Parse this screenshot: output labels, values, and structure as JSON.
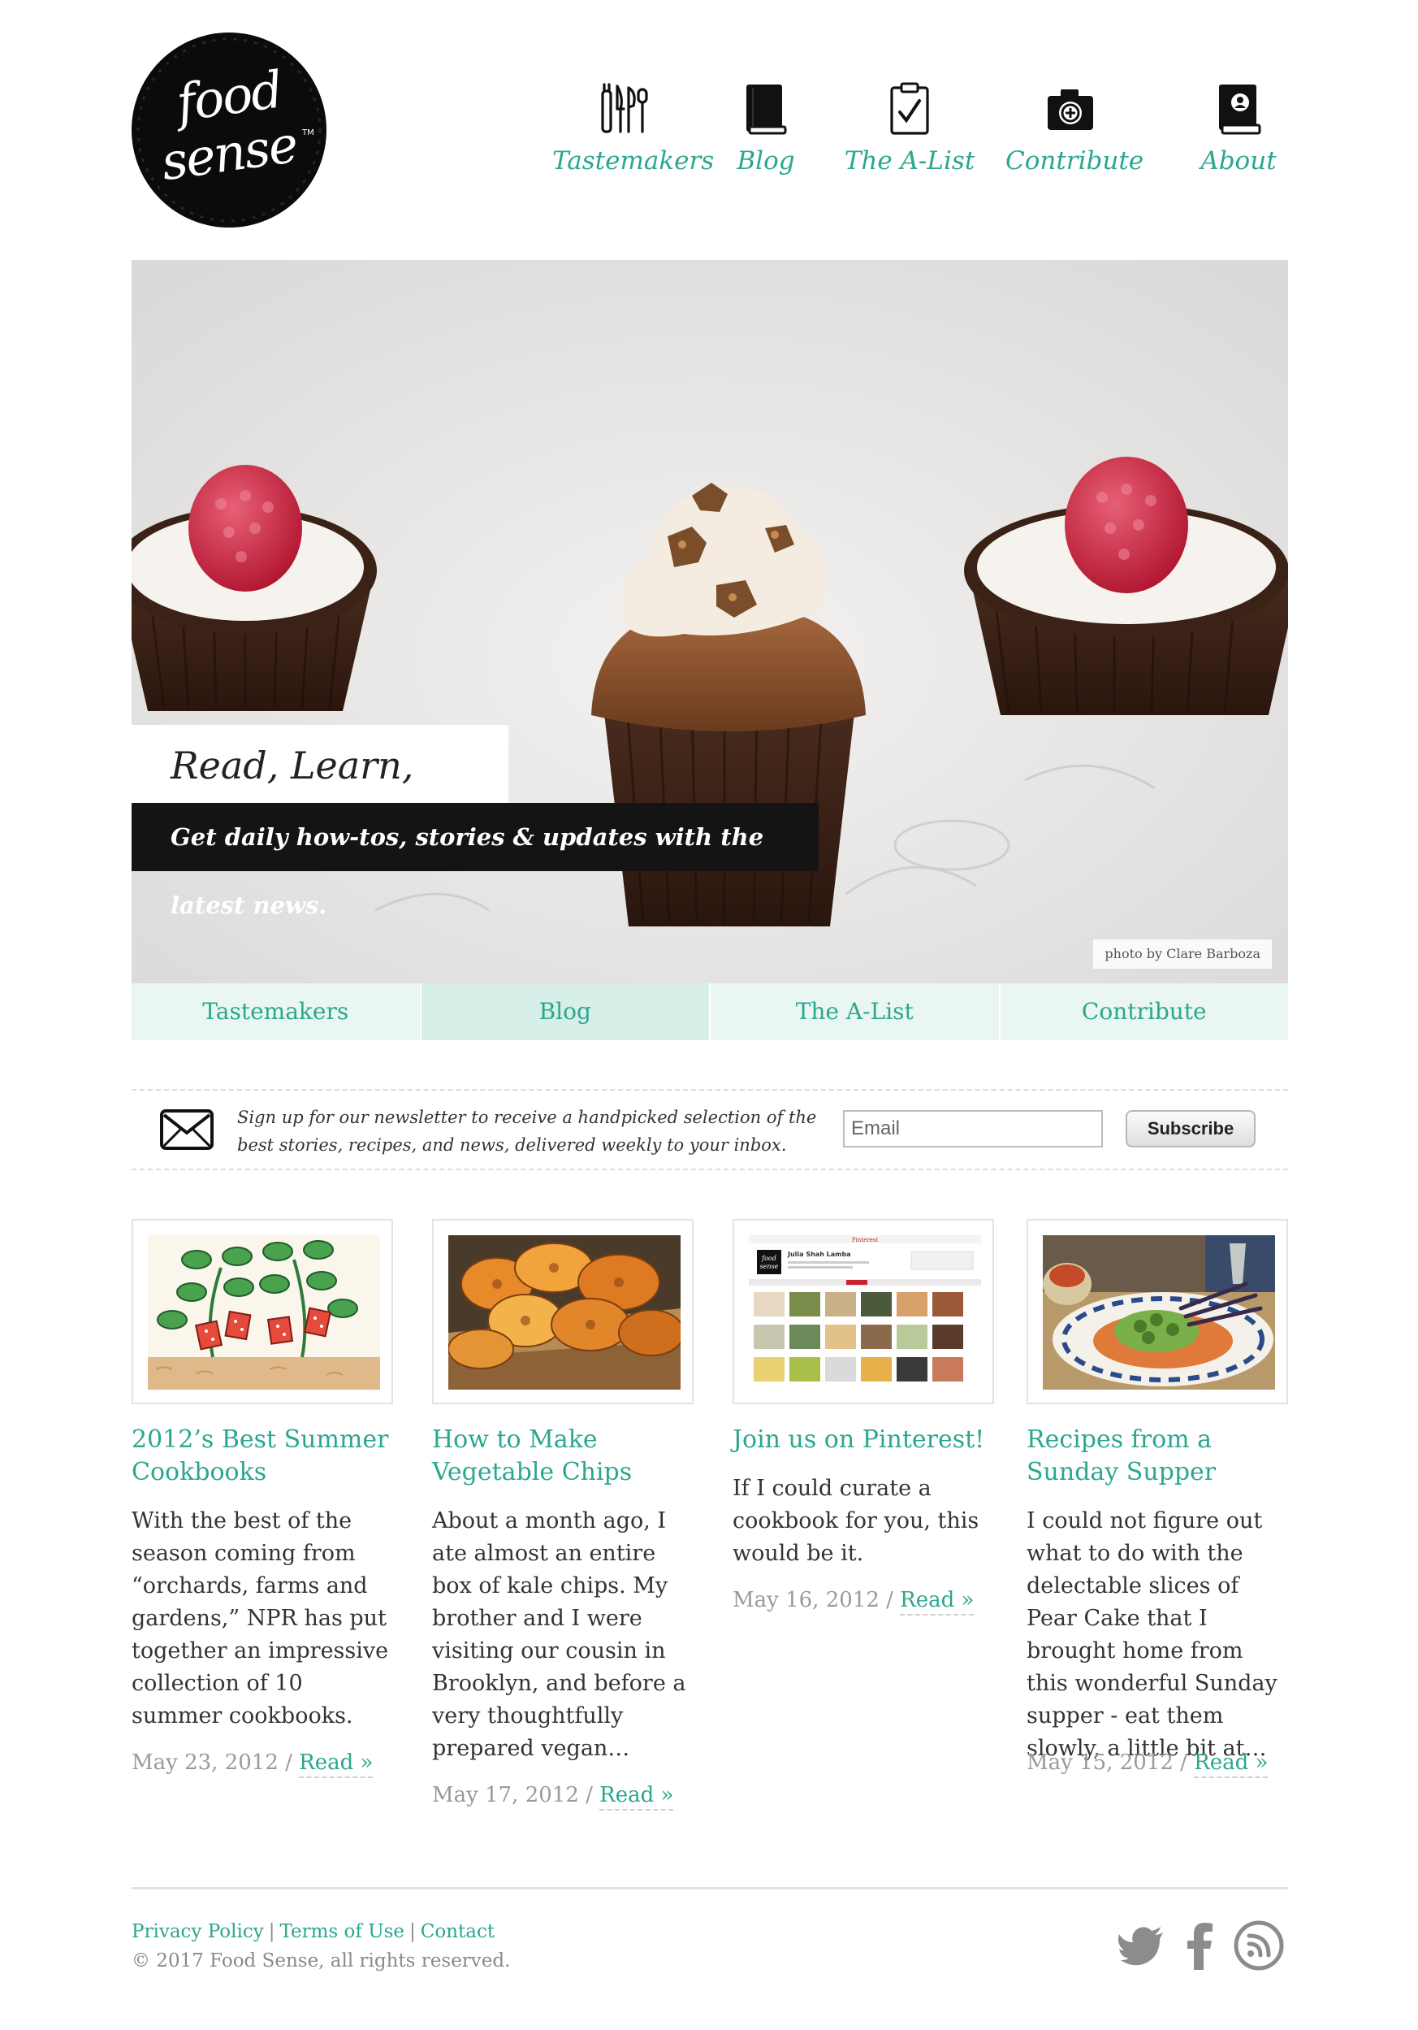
{
  "brand": {
    "logo_line1": "food",
    "logo_line2": "sense",
    "logo_tm": "TM"
  },
  "nav": {
    "items": [
      {
        "label": "Tastemakers",
        "icon": "utensils-icon"
      },
      {
        "label": "Blog",
        "icon": "book-icon"
      },
      {
        "label": "The A-List",
        "icon": "clipboard-check-icon"
      },
      {
        "label": "Contribute",
        "icon": "camera-plus-icon"
      },
      {
        "label": "About",
        "icon": "profile-book-icon"
      }
    ]
  },
  "hero": {
    "title": "Read, Learn, Share",
    "subtitle": "Get daily how-tos, stories & updates with the latest news.",
    "credit": "photo by Clare Barboza"
  },
  "tabs": {
    "items": [
      "Tastemakers",
      "Blog",
      "The A-List",
      "Contribute"
    ],
    "active": "Blog"
  },
  "newsletter": {
    "text": "Sign up for our newsletter to receive a handpicked selection of the best stories, recipes, and news, delivered weekly to your inbox.",
    "email_placeholder": "Email",
    "button_label": "Subscribe",
    "icon": "envelope-icon"
  },
  "posts": [
    {
      "title": "2012’s Best Summer Cookbooks",
      "excerpt": "With the best of the season coming from “orchards, farms and gardens,” NPR has put together an impressive collection of 10 summer cookbooks.",
      "date": "May 23, 2012",
      "sep": "/",
      "read": "Read »"
    },
    {
      "title": "How to Make Vegetable Chips",
      "excerpt": "About a month ago, I ate almost an entire box of kale chips. My brother and I were visiting our cousin in Brooklyn, and before a very thoughtfully prepared vegan…",
      "date": "May 17, 2012",
      "sep": "/",
      "read": "Read »"
    },
    {
      "title": "Join us on Pinterest!",
      "excerpt": "If I could curate a cookbook for you, this would be it.",
      "date": "May 16, 2012",
      "sep": "/",
      "read": "Read »",
      "thumb_text": {
        "brand": "Pinterest",
        "profile_name": "Julia Shah Lamba",
        "logo_line1": "food",
        "logo_line2": "sense"
      }
    },
    {
      "title": "Recipes from a Sunday Supper",
      "excerpt": "I could not figure out what to do with the delectable slices of Pear Cake that I brought home from this wonderful Sunday supper - eat them slowly, a little bit at…",
      "date": "May 15, 2012",
      "sep": "/",
      "read": "Read »"
    }
  ],
  "footer": {
    "links": [
      "Privacy Policy",
      "Terms of Use",
      "Contact"
    ],
    "separator": "|",
    "copyright": "© 2017 Food Sense, all rights reserved.",
    "social": [
      "twitter-icon",
      "facebook-icon",
      "rss-icon"
    ]
  },
  "colors": {
    "accent": "#2aa78e",
    "tab_bg": "#e9f6f2",
    "tab_active_bg": "#d6efe8",
    "hero_sub_bg": "#141414",
    "muted_text": "#9a9a9a"
  }
}
